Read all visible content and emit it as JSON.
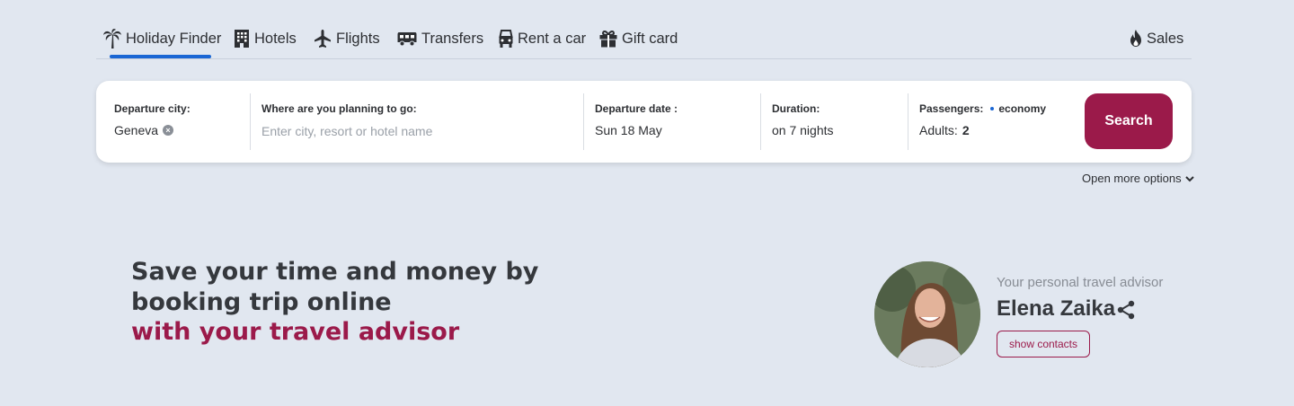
{
  "nav": {
    "items": [
      {
        "label": "Holiday Finder",
        "icon": "palm-tree-icon",
        "active": true
      },
      {
        "label": "Hotels",
        "icon": "hotel-building-icon"
      },
      {
        "label": "Flights",
        "icon": "airplane-icon"
      },
      {
        "label": "Transfers",
        "icon": "bus-icon"
      },
      {
        "label": "Rent a car",
        "icon": "car-icon"
      },
      {
        "label": "Gift card",
        "icon": "gift-icon"
      }
    ],
    "sales": {
      "label": "Sales",
      "icon": "flame-icon"
    },
    "active_color": "#1a66d4"
  },
  "search": {
    "departure": {
      "label": "Departure city:",
      "value": "Geneva"
    },
    "destination": {
      "label": "Where are you planning to go:",
      "placeholder": "Enter city, resort or hotel name",
      "value": ""
    },
    "date": {
      "label": "Departure date :",
      "value": "Sun 18 May"
    },
    "duration": {
      "label": "Duration:",
      "value": "on 7 nights"
    },
    "passengers": {
      "label": "Passengers:",
      "class": "economy",
      "adults_label": "Adults:",
      "adults": "2"
    },
    "button": "Search",
    "more_options": "Open more options"
  },
  "promo": {
    "line1": "Save your time and money by",
    "line2": "booking trip online",
    "line3": "with your travel advisor"
  },
  "advisor": {
    "subtitle": "Your personal travel advisor",
    "name": "Elena Zaika",
    "contacts_button": "show contacts"
  },
  "colors": {
    "brand": "#9b1a4a",
    "background": "#e1e7f0",
    "accent": "#1a66d4"
  }
}
